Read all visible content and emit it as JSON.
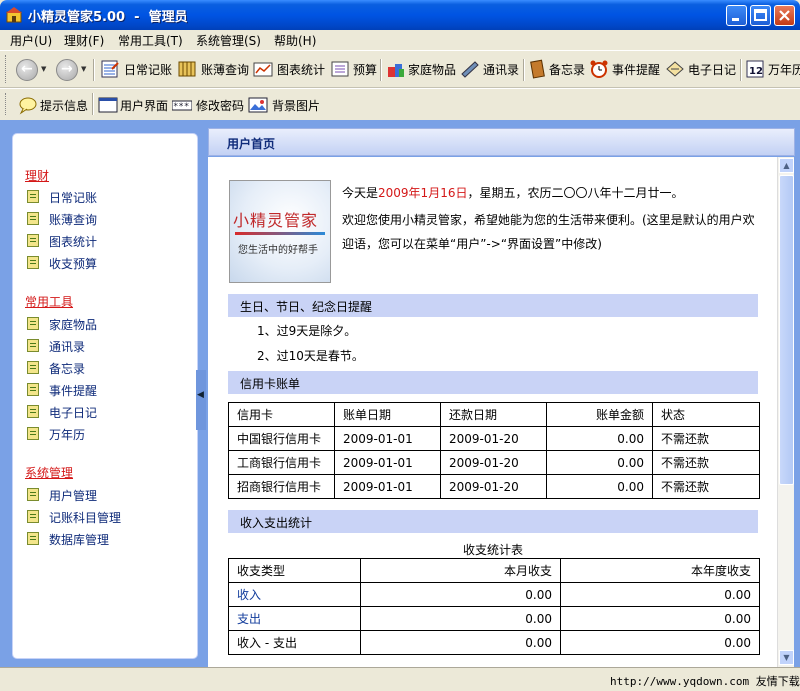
{
  "window": {
    "title": "小精灵管家5.00  -  管理员"
  },
  "menu": [
    "用户(U)",
    "理财(F)",
    "常用工具(T)",
    "系统管理(S)",
    "帮助(H)"
  ],
  "toolbar": {
    "row1": [
      {
        "label": "日常记账",
        "icon": "ledger-icon"
      },
      {
        "label": "账薄查询",
        "icon": "book-icon"
      },
      {
        "label": "图表统计",
        "icon": "chart-icon"
      },
      {
        "label": "预算",
        "icon": "budget-icon"
      },
      {
        "label": "家庭物品",
        "icon": "items-icon"
      },
      {
        "label": "通讯录",
        "icon": "phone-icon"
      },
      {
        "label": "备忘录",
        "icon": "memo-icon"
      },
      {
        "label": "事件提醒",
        "icon": "clock-icon"
      },
      {
        "label": "电子日记",
        "icon": "diary-icon"
      },
      {
        "label": "万年历",
        "icon": "calendar-icon"
      }
    ],
    "row2": [
      {
        "label": "提示信息",
        "icon": "tip-icon"
      },
      {
        "label": "用户界面",
        "icon": "window-icon"
      },
      {
        "label": "修改密码",
        "icon": "password-icon"
      },
      {
        "label": "背景图片",
        "icon": "image-icon"
      }
    ]
  },
  "sidebar": {
    "groups": [
      {
        "title": "理财",
        "items": [
          "日常记账",
          "账薄查询",
          "图表统计",
          "收支预算"
        ]
      },
      {
        "title": "常用工具",
        "items": [
          "家庭物品",
          "通讯录",
          "备忘录",
          "事件提醒",
          "电子日记",
          "万年历"
        ]
      },
      {
        "title": "系统管理",
        "items": [
          "用户管理",
          "记账科目管理",
          "数据库管理"
        ]
      }
    ]
  },
  "main": {
    "header": "用户首页",
    "logo": {
      "name": "小精灵管家",
      "slogan": "您生活中的好帮手"
    },
    "welcome": {
      "prefix": "今天是",
      "date": "2009年1月16日",
      "suffix": "，星期五，农历二〇〇八年十二月廿一。",
      "message": "欢迎您使用小精灵管家，希望她能为您的生活带来便利。(这里是默认的用户欢迎语，您可以在菜单“用户”->“界面设置”中修改)"
    },
    "reminders": {
      "title": "生日、节日、纪念日提醒",
      "items": [
        "1、过9天是除夕。",
        "2、过10天是春节。"
      ]
    },
    "credit": {
      "title": "信用卡账单",
      "headers": [
        "信用卡",
        "账单日期",
        "还款日期",
        "账单金额",
        "状态"
      ],
      "rows": [
        [
          "中国银行信用卡",
          "2009-01-01",
          "2009-01-20",
          "0.00",
          "不需还款"
        ],
        [
          "工商银行信用卡",
          "2009-01-01",
          "2009-01-20",
          "0.00",
          "不需还款"
        ],
        [
          "招商银行信用卡",
          "2009-01-01",
          "2009-01-20",
          "0.00",
          "不需还款"
        ]
      ]
    },
    "stats": {
      "title": "收入支出统计",
      "caption": "收支统计表",
      "headers": [
        "收支类型",
        "本月收支",
        "本年度收支"
      ],
      "rows": [
        [
          "收入",
          "0.00",
          "0.00"
        ],
        [
          "支出",
          "0.00",
          "0.00"
        ],
        [
          "收入 - 支出",
          "0.00",
          "0.00"
        ]
      ]
    }
  },
  "status": {
    "watermark": "http://www.yqdown.com 友情下载"
  }
}
